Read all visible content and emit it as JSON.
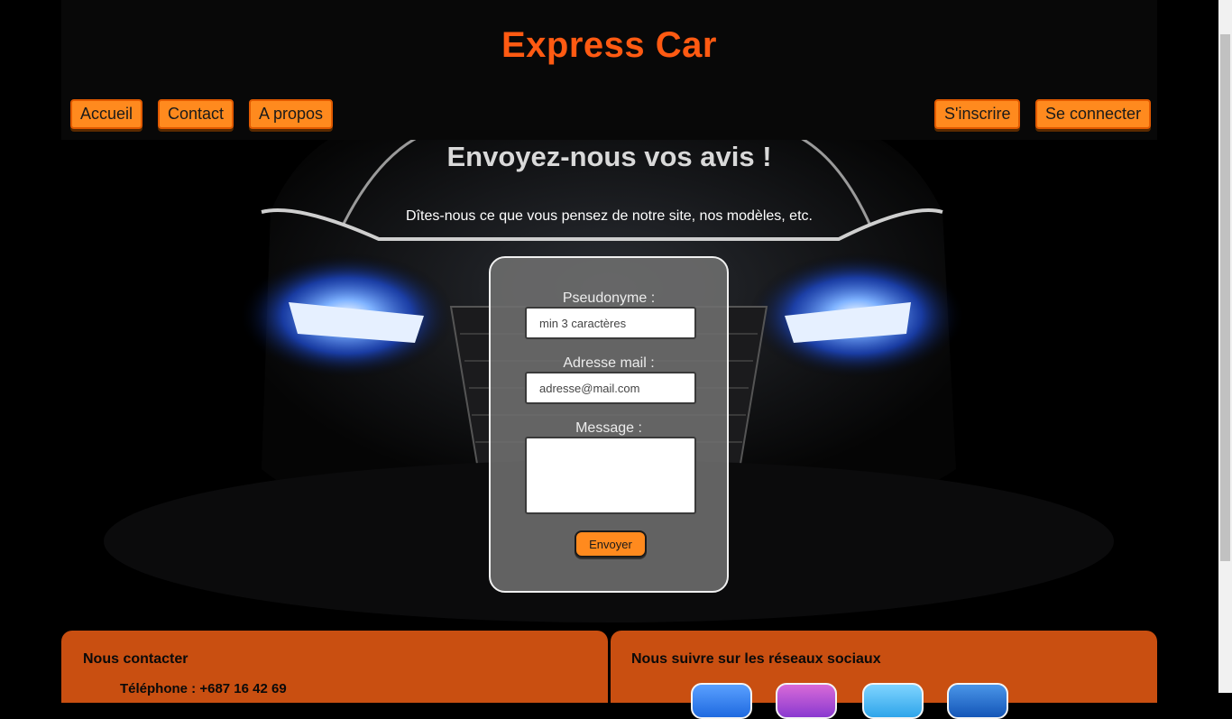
{
  "header": {
    "title": "Express Car",
    "nav_left": [
      "Accueil",
      "Contact",
      "A propos"
    ],
    "nav_right": [
      "S'inscrire",
      "Se connecter"
    ]
  },
  "hero": {
    "title": "Envoyez-nous vos avis !",
    "subtitle": "Dîtes-nous ce que vous pensez de notre site, nos modèles, etc."
  },
  "form": {
    "pseudo_label": "Pseudonyme :",
    "pseudo_placeholder": "min 3 caractères",
    "email_label": "Adresse mail :",
    "email_placeholder": "adresse@mail.com",
    "message_label": "Message :",
    "submit_label": "Envoyer"
  },
  "footer": {
    "contact_heading": "Nous contacter",
    "phone": "Téléphone : +687 16 42 69",
    "social_heading": "Nous suivre sur les réseaux sociaux",
    "social_icons": [
      "facebook-icon",
      "instagram-icon",
      "twitter-icon",
      "linkedin-icon"
    ]
  },
  "colors": {
    "accent": "#ff5a12",
    "button": "#ff8a1e",
    "footer": "#c94f11"
  }
}
